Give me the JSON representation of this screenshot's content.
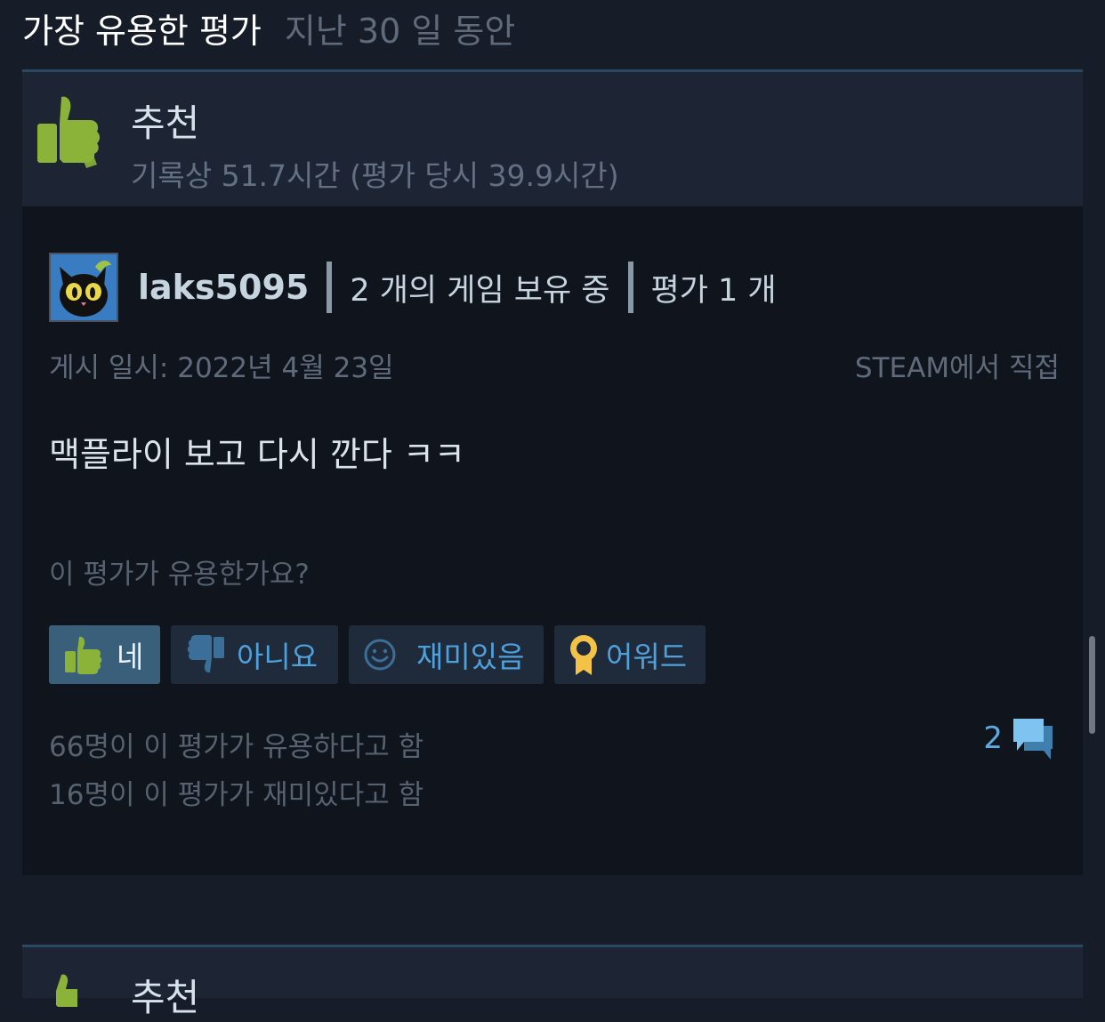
{
  "section": {
    "title": "가장 유용한 평가",
    "period": "지난 30 일 동안"
  },
  "review": {
    "recommendation": "추천",
    "hours": "기록상 51.7시간 (평가 당시 39.9시간)",
    "author": {
      "name": "laks5095",
      "games_owned": "2 개의 게임 보유 중",
      "review_count": "평가 1 개"
    },
    "posted": "게시 일시: 2022년 4월 23일",
    "source": "STEAM에서 직접",
    "body": "맥플라이 보고 다시 깐다 ㅋㅋ",
    "helpful_question": "이 평가가 유용한가요?",
    "buttons": {
      "yes": "네",
      "no": "아니요",
      "funny": "재미있음",
      "award": "어워드"
    },
    "helpful_stat": "66명이 이 평가가 유용하다고 함",
    "funny_stat": "16명이 이 평가가 재미있다고 함",
    "comment_count": "2"
  },
  "next_review": {
    "recommendation": "추천"
  },
  "colors": {
    "thumb_green": "#8bb33a",
    "accent_blue": "#4ea1dc",
    "award_gold": "#f3c246"
  }
}
